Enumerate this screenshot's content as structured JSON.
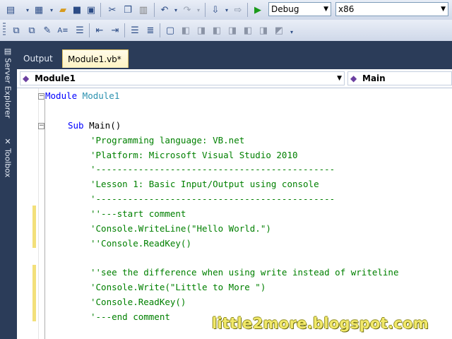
{
  "toolbar": {
    "config_value": "Debug",
    "platform_value": "x86",
    "icons_row1": [
      "new-project-icon",
      "add-item-icon",
      "open-icon",
      "save-icon",
      "save-all-icon",
      "cut-icon",
      "copy-icon",
      "paste-icon",
      "undo-icon",
      "redo-icon",
      "navigate-icon",
      "find-icon",
      "start-debug-icon"
    ],
    "icons_row2": [
      "toolbar-icon-1",
      "toolbar-icon-2",
      "toolbar-icon-3",
      "toolbar-icon-4",
      "toolbar-icon-5",
      "indent-icon",
      "outdent-icon",
      "comment-icon",
      "uncomment-icon",
      "bookmark-icon",
      "bookmark-prev-icon",
      "bookmark-next-icon",
      "bookmark-folder-icon",
      "bookmark-icon-2",
      "bookmark-icon-3",
      "bookmark-clear-icon"
    ]
  },
  "side_tabs": [
    "Server Explorer",
    "Toolbox"
  ],
  "tabs": [
    {
      "label": "Output",
      "active": false
    },
    {
      "label": "Module1.vb*",
      "active": true
    }
  ],
  "navbar": {
    "left": "Module1",
    "right": "Main"
  },
  "code": {
    "l1_kw": "Module",
    "l1_name": " Module1",
    "l2_kw": "Sub",
    "l2_rest": " Main()",
    "c1": "'Programming language: VB.net",
    "c2": "'Platform: Microsoft Visual Studio 2010",
    "c3": "'---------------------------------------------",
    "c4": "'Lesson 1: Basic Input/Output using console",
    "c5": "'---------------------------------------------",
    "c6": "''---start comment",
    "c7": "'Console.WriteLine(\"Hello World.\")",
    "c8": "''Console.ReadKey()",
    "c9": "''see the difference when using write instead of writeline",
    "c10": "'Console.Write(\"Little to More \")",
    "c11": "'Console.ReadKey()",
    "c12": "'---end comment"
  },
  "watermark": "little2more.blogspot.com",
  "colors": {
    "keyword": "#0000ff",
    "type": "#2b91af",
    "comment": "#008000",
    "chrome": "#2b3c59"
  }
}
